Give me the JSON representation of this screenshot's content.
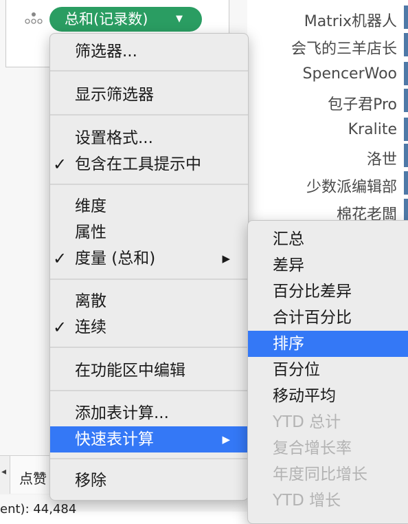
{
  "marks": {
    "pill_label": "总和(记录数)"
  },
  "names": [
    "Matrix机器人",
    "会飞的三羊店长",
    "SpencerWoo",
    "包子君Pro",
    "Kralite",
    "洛世",
    "少数派编辑部",
    "棉花老闆"
  ],
  "shelf": {
    "tab_label": "点赞"
  },
  "status": {
    "text": "ent): 44,484"
  },
  "context_menu": {
    "items": [
      {
        "label": "筛选器..."
      },
      {
        "label": "显示筛选器"
      },
      {
        "label": "设置格式..."
      },
      {
        "label": "包含在工具提示中",
        "checked": true
      },
      {
        "label": "维度"
      },
      {
        "label": "属性"
      },
      {
        "label": "度量 (总和)",
        "checked": true,
        "submenu": true
      },
      {
        "label": "离散"
      },
      {
        "label": "连续",
        "checked": true
      },
      {
        "label": "在功能区中编辑"
      },
      {
        "label": "添加表计算..."
      },
      {
        "label": "快速表计算",
        "submenu": true,
        "highlighted": true
      },
      {
        "label": "移除"
      }
    ]
  },
  "quick_table_calc_submenu": {
    "items": [
      {
        "label": "汇总",
        "enabled": true
      },
      {
        "label": "差异",
        "enabled": true
      },
      {
        "label": "百分比差异",
        "enabled": true
      },
      {
        "label": "合计百分比",
        "enabled": true
      },
      {
        "label": "排序",
        "enabled": true,
        "highlighted": true
      },
      {
        "label": "百分位",
        "enabled": true
      },
      {
        "label": "移动平均",
        "enabled": true
      },
      {
        "label": "YTD 总计",
        "enabled": false
      },
      {
        "label": "复合增长率",
        "enabled": false
      },
      {
        "label": "年度同比增长",
        "enabled": false
      },
      {
        "label": "YTD 增长",
        "enabled": false
      }
    ]
  },
  "colors": {
    "pill": "#2a9d62",
    "highlight": "#3478f6",
    "bar": "#4e79a7"
  }
}
